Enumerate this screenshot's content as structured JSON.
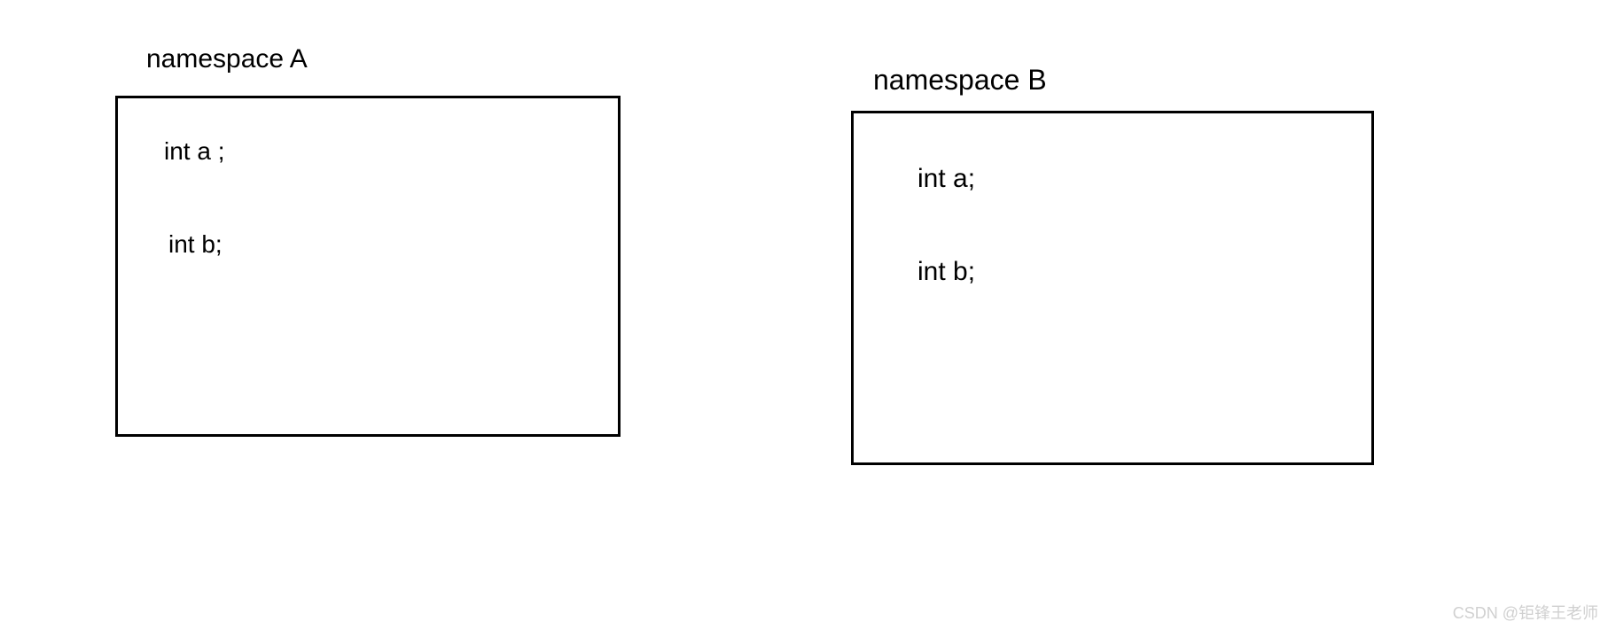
{
  "namespaces": [
    {
      "label": "namespace A",
      "vars": [
        "int a ;",
        "int b;"
      ]
    },
    {
      "label": "namespace B",
      "vars": [
        "int a;",
        "int b;"
      ]
    }
  ],
  "watermark": "CSDN @钜锋王老师"
}
